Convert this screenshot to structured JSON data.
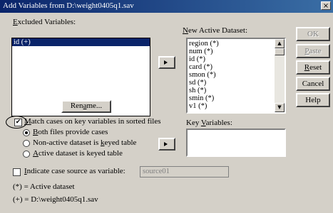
{
  "window": {
    "title": "Add Variables from D:\\weight0405q1.sav",
    "close_glyph": "×"
  },
  "excluded": {
    "label_pre": "",
    "label_u": "E",
    "label_post": "xcluded Variables:",
    "items": [
      "id (+)"
    ]
  },
  "rename_button": {
    "pre": "Ren",
    "u": "a",
    "post": "me..."
  },
  "new_active": {
    "label_u": "N",
    "label_post": "ew Active Dataset:",
    "items": [
      "region (*)",
      "num (*)",
      "id (*)",
      "card (*)",
      "smon (*)",
      "sd (*)",
      "sh (*)",
      "smin (*)",
      "v1 (*)"
    ]
  },
  "buttons": {
    "ok": "OK",
    "paste_u": "P",
    "paste_post": "aste",
    "reset_u": "R",
    "reset_post": "eset",
    "cancel": "Cancel",
    "help": "Help"
  },
  "match": {
    "checkbox_checked": true,
    "label_u": "M",
    "label_post": "atch cases on key variables in sorted files",
    "options": [
      {
        "u": "B",
        "post": "oth files provide cases",
        "pre": "",
        "selected": true
      },
      {
        "pre": "Non-active dataset is ",
        "u": "k",
        "post": "eyed table",
        "selected": false
      },
      {
        "pre": "",
        "u": "A",
        "post": "ctive dataset is keyed table",
        "selected": false
      }
    ]
  },
  "key_variables": {
    "label_pre": "Key ",
    "label_u": "V",
    "label_post": "ariables:"
  },
  "indicate": {
    "checked": false,
    "label_u": "I",
    "label_post": "ndicate case source as variable:",
    "value": "source01"
  },
  "legend": {
    "star": "(*) = Active dataset",
    "plus": "(+) = D:\\weight0405q1.sav"
  }
}
